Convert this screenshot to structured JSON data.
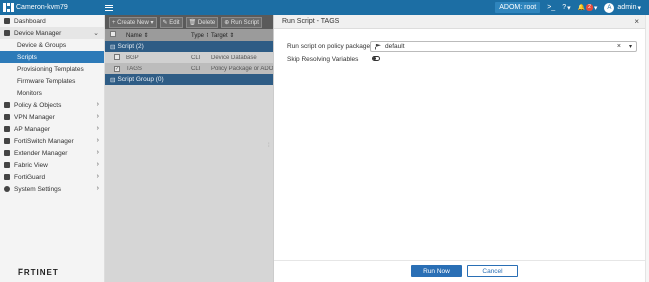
{
  "topbar": {
    "title": "Cameron-kvm79",
    "adom_label": "ADOM: root",
    "cli_icon": ">_",
    "help_icon": "?",
    "help_caret": "▾",
    "bell_icon": "🔔",
    "notification_count": "2",
    "bell_caret": "▾",
    "avatar_letter": "A",
    "user": "admin",
    "user_caret": "▾"
  },
  "sidebar": {
    "items": [
      {
        "label": "Dashboard"
      },
      {
        "label": "Device Manager",
        "chevron": "⌄"
      },
      {
        "label": "Device & Groups"
      },
      {
        "label": "Scripts"
      },
      {
        "label": "Provisioning Templates"
      },
      {
        "label": "Firmware Templates"
      },
      {
        "label": "Monitors"
      },
      {
        "label": "Policy & Objects",
        "chevron": "›"
      },
      {
        "label": "VPN Manager",
        "chevron": "›"
      },
      {
        "label": "AP Manager",
        "chevron": "›"
      },
      {
        "label": "FortiSwitch Manager",
        "chevron": "›"
      },
      {
        "label": "Extender Manager",
        "chevron": "›"
      },
      {
        "label": "Fabric View",
        "chevron": "›"
      },
      {
        "label": "FortiGuard",
        "chevron": "›"
      },
      {
        "label": "System Settings",
        "chevron": "›"
      }
    ],
    "logo_text": "F̅RTINET"
  },
  "main": {
    "toolbar": {
      "create_new": "+ Create New ▾",
      "edit": "✎ Edit",
      "delete": "🗑 Delete",
      "run_script": "⊕ Run Script"
    },
    "columns": [
      "",
      "Name ⇕",
      "Type ⇕",
      "Target ⇕"
    ],
    "groups": [
      {
        "label": "Script (2)",
        "toggle": "⊟"
      },
      {
        "label": "Script Group (0)",
        "toggle": "⊟"
      }
    ],
    "rows": [
      {
        "check": "",
        "name": "BGP",
        "type": "CLI",
        "target": "Device Database"
      },
      {
        "check": "✓",
        "name": "TAGS",
        "type": "CLI",
        "target": "Policy Package or ADOM"
      }
    ],
    "splitter": "⁞"
  },
  "dialog": {
    "title": "Run Script - TAGS",
    "close_icon": "×",
    "policy_label": "Run script on policy package",
    "policy_value": "default",
    "clear_icon": "×",
    "caret_icon": "▾",
    "skip_label": "Skip Resolving Variables",
    "skip_resolving": false,
    "run_now": "Run Now",
    "cancel": "Cancel"
  },
  "colors": {
    "topbar": "#1c6ea4",
    "active_nav": "#2d7ab8",
    "primary_button": "#2a6fb5",
    "group_row": "#2e5c85"
  }
}
